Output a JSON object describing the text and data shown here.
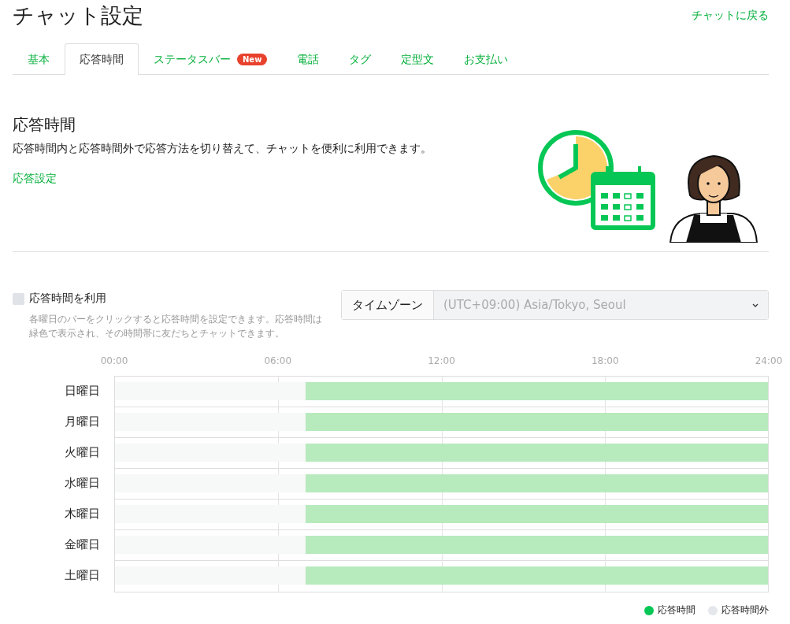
{
  "page": {
    "title": "チャット設定",
    "back_link": "チャットに戻る"
  },
  "tabs": [
    {
      "label": "基本",
      "selected": false
    },
    {
      "label": "応答時間",
      "selected": true
    },
    {
      "label": "ステータスバー",
      "selected": false,
      "badge": "New"
    },
    {
      "label": "電話",
      "selected": false
    },
    {
      "label": "タグ",
      "selected": false
    },
    {
      "label": "定型文",
      "selected": false
    },
    {
      "label": "お支払い",
      "selected": false
    }
  ],
  "section": {
    "heading": "応答時間",
    "description": "応答時間内と応答時間外で応答方法を切り替えて、チャットを便利に利用できます。",
    "link": "応答設定"
  },
  "use_hours": {
    "label": "応答時間を利用",
    "checked": false,
    "help": "各曜日のバーをクリックすると応答時間を設定できます。応答時間は緑色で表示され、その時間帯に友だちとチャットできます。"
  },
  "timezone": {
    "label": "タイムゾーン",
    "value": "(UTC+09:00) Asia/Tokyo, Seoul"
  },
  "schedule": {
    "ticks": [
      "00:00",
      "06:00",
      "12:00",
      "18:00",
      "24:00"
    ],
    "days": [
      {
        "name": "日曜日",
        "level": 0.708
      },
      {
        "name": "月曜日",
        "level": 0.708
      },
      {
        "name": "火曜日",
        "level": 0.708
      },
      {
        "name": "水曜日",
        "level": 0.708
      },
      {
        "name": "木曜日",
        "level": 0.708
      },
      {
        "name": "金曜日",
        "level": 0.708
      },
      {
        "name": "土曜日",
        "level": 0.708
      }
    ]
  },
  "legend": [
    {
      "label": "応答時間",
      "color": "#06c755"
    },
    {
      "label": "応答時間外",
      "color": "#e4e7eb"
    }
  ]
}
